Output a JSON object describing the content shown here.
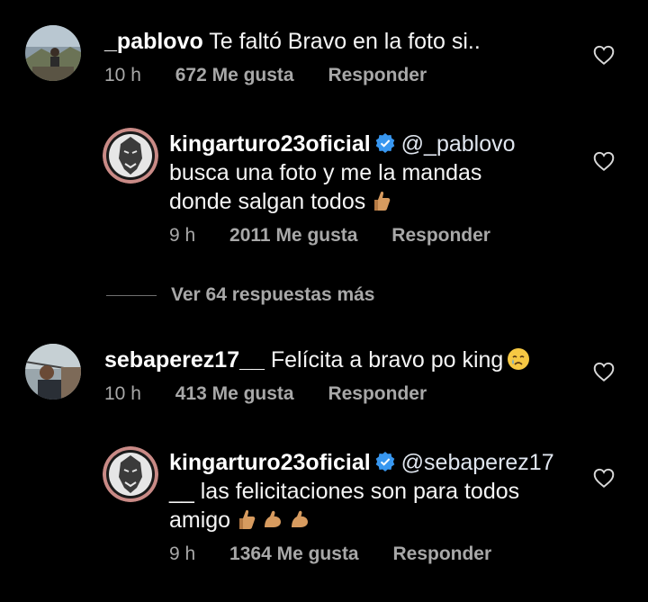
{
  "comments": [
    {
      "username": "_pablovo",
      "text": "Te faltó Bravo en la foto si..",
      "time": "10 h",
      "likes": "672 Me gusta",
      "reply": "Responder"
    },
    {
      "username": "kingarturo23oficial",
      "mention": "@_pablovo",
      "line1": "busca una foto y me la mandas",
      "line2": "donde salgan todos",
      "time": "9 h",
      "likes": "2011 Me gusta",
      "reply": "Responder"
    },
    {
      "username": "sebaperez17__",
      "text": "Felícita a bravo po king",
      "time": "10 h",
      "likes": "413 Me gusta",
      "reply": "Responder"
    },
    {
      "username": "kingarturo23oficial",
      "mention": "@sebaperez17",
      "line1": "__ las felicitaciones son para todos",
      "line2": "amigo",
      "time": "9 h",
      "likes": "1364 Me gusta",
      "reply": "Responder"
    }
  ],
  "view_more": "Ver 64 respuestas más",
  "icons": {
    "heart": "heart-outline-icon",
    "verified": "verified-badge-icon"
  },
  "colors": {
    "background": "#000000",
    "verified": "#3897f0",
    "muted": "#a8a8a8"
  }
}
